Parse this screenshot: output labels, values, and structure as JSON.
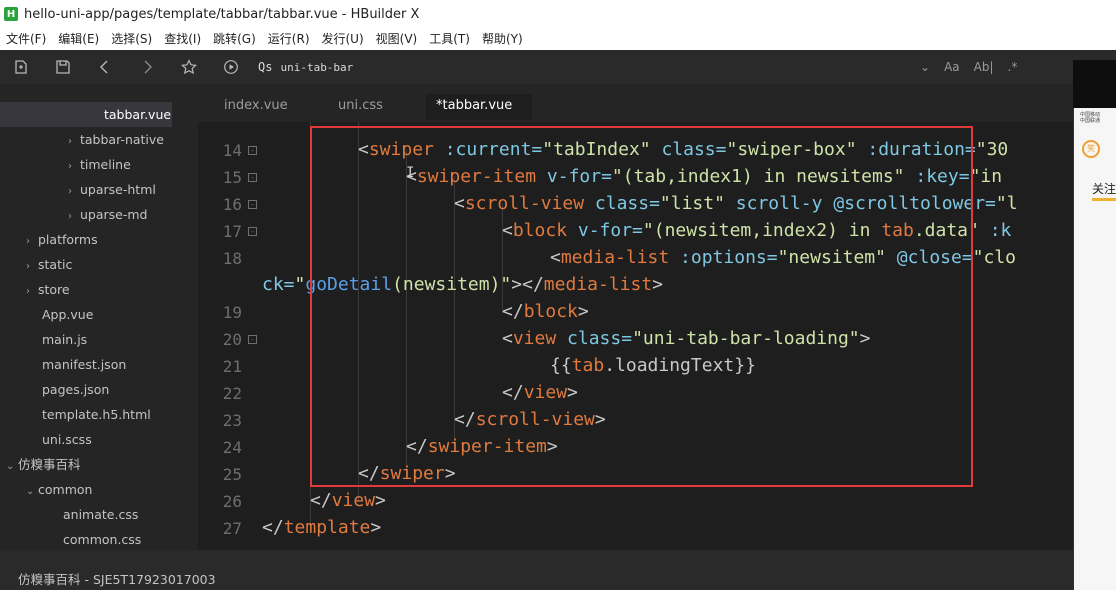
{
  "window": {
    "logo": "H",
    "title": "hello-uni-app/pages/template/tabbar/tabbar.vue - HBuilder X"
  },
  "menu": [
    "文件(F)",
    "编辑(E)",
    "选择(S)",
    "查找(I)",
    "跳转(G)",
    "运行(R)",
    "发行(U)",
    "视图(V)",
    "工具(T)",
    "帮助(Y)"
  ],
  "toolbar": {
    "search_prefix": "Qs",
    "search_value": "uni-tab-bar",
    "right_icons": [
      "Aa",
      "Ab|",
      ".*"
    ]
  },
  "sidebar": {
    "items": [
      {
        "label": "tabbar.vue",
        "arrow": ""
      },
      {
        "label": "tabbar-native",
        "arrow": "›"
      },
      {
        "label": "timeline",
        "arrow": "›"
      },
      {
        "label": "uparse-html",
        "arrow": "›"
      },
      {
        "label": "uparse-md",
        "arrow": "›"
      },
      {
        "label": "platforms",
        "arrow": "›"
      },
      {
        "label": "static",
        "arrow": "›"
      },
      {
        "label": "store",
        "arrow": "›"
      },
      {
        "label": "App.vue",
        "arrow": ""
      },
      {
        "label": "main.js",
        "arrow": ""
      },
      {
        "label": "manifest.json",
        "arrow": ""
      },
      {
        "label": "pages.json",
        "arrow": ""
      },
      {
        "label": "template.h5.html",
        "arrow": ""
      },
      {
        "label": "uni.scss",
        "arrow": ""
      },
      {
        "label": "仿糗事百科",
        "arrow": "⌄"
      },
      {
        "label": "common",
        "arrow": "⌄"
      },
      {
        "label": "animate.css",
        "arrow": ""
      },
      {
        "label": "common.css",
        "arrow": ""
      }
    ]
  },
  "tabs": [
    {
      "label": "index.vue"
    },
    {
      "label": "uni.css"
    },
    {
      "label": "*tabbar.vue"
    }
  ],
  "editor": {
    "lines": [
      {
        "num": "14",
        "fold": "⊟"
      },
      {
        "num": "15",
        "fold": "⊟"
      },
      {
        "num": "16",
        "fold": "⊟"
      },
      {
        "num": "17",
        "fold": "⊟"
      },
      {
        "num": "18",
        "fold": ""
      },
      {
        "num": "",
        "fold": ""
      },
      {
        "num": "19",
        "fold": ""
      },
      {
        "num": "20",
        "fold": "⊟"
      },
      {
        "num": "21",
        "fold": ""
      },
      {
        "num": "22",
        "fold": ""
      },
      {
        "num": "23",
        "fold": ""
      },
      {
        "num": "24",
        "fold": ""
      },
      {
        "num": "25",
        "fold": ""
      },
      {
        "num": "26",
        "fold": ""
      },
      {
        "num": "27",
        "fold": ""
      }
    ],
    "tokens": {
      "l14": [
        "<",
        "swiper",
        " :current=",
        "\"tabIndex\"",
        " class=",
        "\"swiper-box\"",
        " :duration=",
        "\"30"
      ],
      "l15": [
        "<",
        "swiper-item",
        " v-for=",
        "\"(tab,index1) in newsitems\"",
        " :key=",
        "\"in"
      ],
      "l16": [
        "<",
        "scroll-view",
        " class=",
        "\"list\"",
        " scroll-y @scrolltolower=",
        "\"l"
      ],
      "l17": [
        "<",
        "block",
        " v-for=",
        "\"(newsitem,index2) in ",
        "tab",
        ".data\"",
        " :k"
      ],
      "l18": [
        "<",
        "media-list",
        " :options=",
        "\"newsitem\"",
        " @close=",
        "\"clo"
      ],
      "l18b": [
        "ck=",
        "\"",
        "goDetail",
        "(newsitem)\"",
        "></",
        "media-list",
        ">"
      ],
      "l19": [
        "</",
        "block",
        ">"
      ],
      "l20": [
        "<",
        "view",
        " class=",
        "\"uni-tab-bar-loading\"",
        ">"
      ],
      "l21": [
        "{{",
        "tab",
        ".loadingText}}"
      ],
      "l22": [
        "</",
        "view",
        ">"
      ],
      "l23": [
        "</",
        "scroll-view",
        ">"
      ],
      "l24": [
        "</",
        "swiper-item",
        ">"
      ],
      "l25": [
        "</",
        "swiper",
        ">"
      ],
      "l26": [
        "</",
        "view",
        ">"
      ],
      "l27": [
        "</",
        "template",
        ">"
      ]
    }
  },
  "phone": {
    "tiny_text": "中国移动\n中国联通",
    "badge": "笑",
    "tab_text": "关注"
  },
  "statusbar": {
    "text": "仿糗事百科 - SJE5T17923017003"
  }
}
